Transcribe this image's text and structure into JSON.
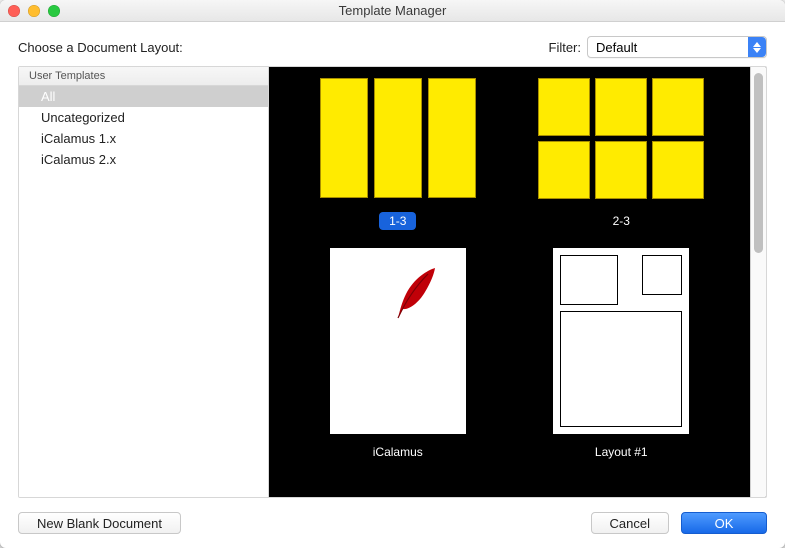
{
  "window": {
    "title": "Template Manager"
  },
  "prompt": "Choose a Document Layout:",
  "filter": {
    "label": "Filter:",
    "value": "Default"
  },
  "sidebar": {
    "header": "User Templates",
    "items": [
      {
        "label": "All",
        "selected": true
      },
      {
        "label": "Uncategorized",
        "selected": false
      },
      {
        "label": "iCalamus 1.x",
        "selected": false
      },
      {
        "label": "iCalamus 2.x",
        "selected": false
      }
    ]
  },
  "templates": [
    {
      "name": "1-3",
      "kind": "grid13",
      "selected": true
    },
    {
      "name": "2-3",
      "kind": "grid23",
      "selected": false
    },
    {
      "name": "iCalamus",
      "kind": "feather",
      "selected": false
    },
    {
      "name": "Layout #1",
      "kind": "layout1",
      "selected": false
    }
  ],
  "buttons": {
    "new_blank": "New Blank Document",
    "cancel": "Cancel",
    "ok": "OK"
  }
}
